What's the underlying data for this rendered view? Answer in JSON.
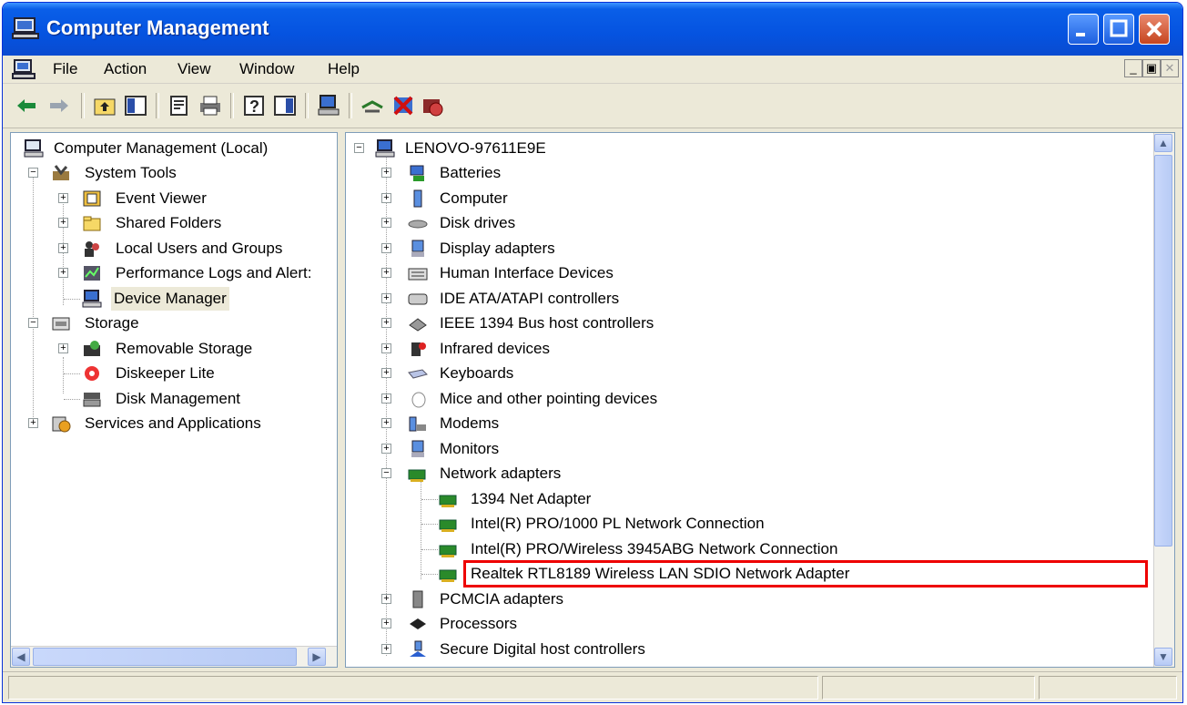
{
  "window": {
    "title": "Computer Management",
    "colors": {
      "titlebar": "#0553e0",
      "highlight_box": "#e00000"
    }
  },
  "menu": [
    "File",
    "Action",
    "View",
    "Window",
    "Help"
  ],
  "left_tree": {
    "root": "Computer Management (Local)",
    "system_tools": "System Tools",
    "system_tools_items": [
      "Event Viewer",
      "Shared Folders",
      "Local Users and Groups",
      "Performance Logs and Alert:",
      "Device Manager"
    ],
    "storage": "Storage",
    "storage_items": [
      "Removable Storage",
      "Diskeeper Lite",
      "Disk Management"
    ],
    "services": "Services and Applications"
  },
  "device_tree": {
    "computer_name": "LENOVO-97611E9E",
    "categories": [
      "Batteries",
      "Computer",
      "Disk drives",
      "Display adapters",
      "Human Interface Devices",
      "IDE ATA/ATAPI controllers",
      "IEEE 1394 Bus host controllers",
      "Infrared devices",
      "Keyboards",
      "Mice and other pointing devices",
      "Modems",
      "Monitors"
    ],
    "network_adapters": "Network adapters",
    "network_items": [
      "1394 Net Adapter",
      "Intel(R) PRO/1000 PL Network Connection",
      "Intel(R) PRO/Wireless 3945ABG Network Connection",
      "Realtek RTL8189 Wireless LAN SDIO Network Adapter"
    ],
    "after_categories": [
      "PCMCIA adapters",
      "Processors",
      "Secure Digital host controllers"
    ]
  }
}
